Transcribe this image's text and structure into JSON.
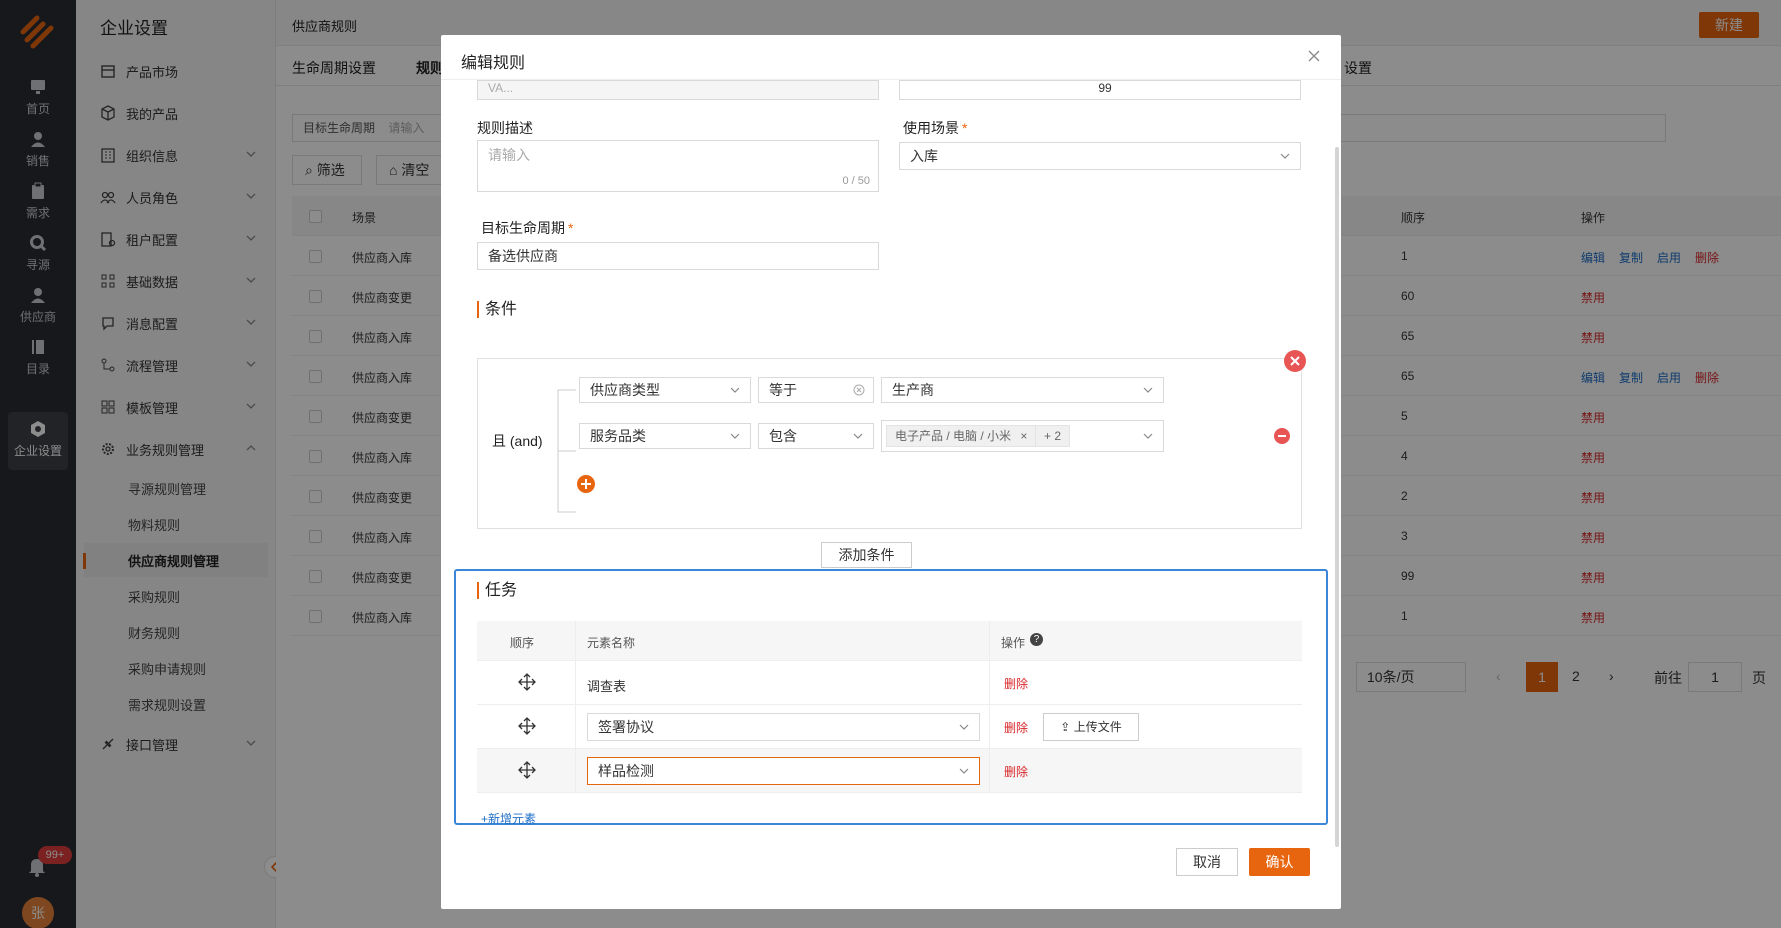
{
  "rail": {
    "items": [
      {
        "label": "首页",
        "icon": "monitor-icon"
      },
      {
        "label": "销售",
        "icon": "user-icon"
      },
      {
        "label": "需求",
        "icon": "clipboard-icon"
      },
      {
        "label": "寻源",
        "icon": "search-icon"
      },
      {
        "label": "供应商",
        "icon": "user-icon"
      },
      {
        "label": "目录",
        "icon": "book-icon"
      },
      {
        "label": "企业设置",
        "icon": "gear-hex-icon"
      }
    ],
    "badge": "99+",
    "avatar": "张"
  },
  "sidebar": {
    "title": "企业设置",
    "items": [
      {
        "label": "产品市场"
      },
      {
        "label": "我的产品"
      },
      {
        "label": "组织信息"
      },
      {
        "label": "人员角色"
      },
      {
        "label": "租户配置"
      },
      {
        "label": "基础数据"
      },
      {
        "label": "消息配置"
      },
      {
        "label": "流程管理"
      },
      {
        "label": "模板管理"
      },
      {
        "label": "业务规则管理"
      }
    ],
    "sub_items": [
      {
        "label": "寻源规则管理"
      },
      {
        "label": "物料规则"
      },
      {
        "label": "供应商规则管理"
      },
      {
        "label": "采购规则"
      },
      {
        "label": "财务规则"
      },
      {
        "label": "采购申请规则"
      },
      {
        "label": "需求规则设置"
      }
    ],
    "last_item": {
      "label": "接口管理"
    }
  },
  "page": {
    "title": "供应商规则",
    "new_button": "新建",
    "tabs": [
      "生命周期设置",
      "规则",
      "设置"
    ],
    "filter_label": "目标生命周期",
    "filter_placeholder": "请输入",
    "filter_button": "筛选",
    "clear_button": "清空",
    "col_scene": "场景",
    "col_order": "顺序",
    "col_ops": "操作",
    "rows": [
      {
        "scene": "供应商入库",
        "order": "1",
        "ops": [
          "编辑",
          "复制",
          "启用",
          "删除"
        ]
      },
      {
        "scene": "供应商变更",
        "order": "60",
        "ops": [
          "禁用"
        ]
      },
      {
        "scene": "供应商入库",
        "order": "65",
        "ops": [
          "禁用"
        ]
      },
      {
        "scene": "供应商入库",
        "order": "65",
        "ops": [
          "编辑",
          "复制",
          "启用",
          "删除"
        ]
      },
      {
        "scene": "供应商变更",
        "order": "5",
        "ops": [
          "禁用"
        ]
      },
      {
        "scene": "供应商入库",
        "order": "4",
        "ops": [
          "禁用"
        ]
      },
      {
        "scene": "供应商变更",
        "order": "2",
        "ops": [
          "禁用"
        ]
      },
      {
        "scene": "供应商入库",
        "order": "3",
        "ops": [
          "禁用"
        ]
      },
      {
        "scene": "供应商变更",
        "order": "99",
        "ops": [
          "禁用"
        ]
      },
      {
        "scene": "供应商入库",
        "order": "1",
        "ops": [
          "禁用"
        ]
      }
    ],
    "pager": {
      "size": "10条/页",
      "current": "1",
      "next": "2",
      "goto_label": "前往",
      "goto_value": "1",
      "page_suffix": "页"
    }
  },
  "dialog": {
    "title": "编辑规则",
    "top_partial_value": "VA...",
    "top_number": "99",
    "desc_label": "规则描述",
    "desc_placeholder": "请输入",
    "desc_counter": "0 / 50",
    "scene_label": "使用场景",
    "scene_value": "入库",
    "lifecycle_label": "目标生命周期",
    "lifecycle_value": "备选供应商",
    "conditions_title": "条件",
    "logic_label": "且 (and)",
    "conditions": [
      {
        "field": "供应商类型",
        "op": "等于",
        "value": "生产商"
      },
      {
        "field": "服务品类",
        "op": "包含",
        "tag": "电子产品 / 电脑 / 小米",
        "more": "+ 2"
      }
    ],
    "add_condition": "添加条件",
    "tasks_title": "任务",
    "task_cols": {
      "order": "顺序",
      "name": "元素名称",
      "ops": "操作"
    },
    "tasks": [
      {
        "name": "调查表",
        "del": "删除"
      },
      {
        "name": "签署协议",
        "del": "删除",
        "upload": "上传文件"
      },
      {
        "name": "样品检测",
        "del": "删除"
      }
    ],
    "add_element": "+新增元素",
    "cancel": "取消",
    "confirm": "确认"
  },
  "colors": {
    "accent": "#e8650f",
    "link": "#1f6fc7",
    "danger": "#d9272a",
    "focus": "#3a87d8"
  }
}
